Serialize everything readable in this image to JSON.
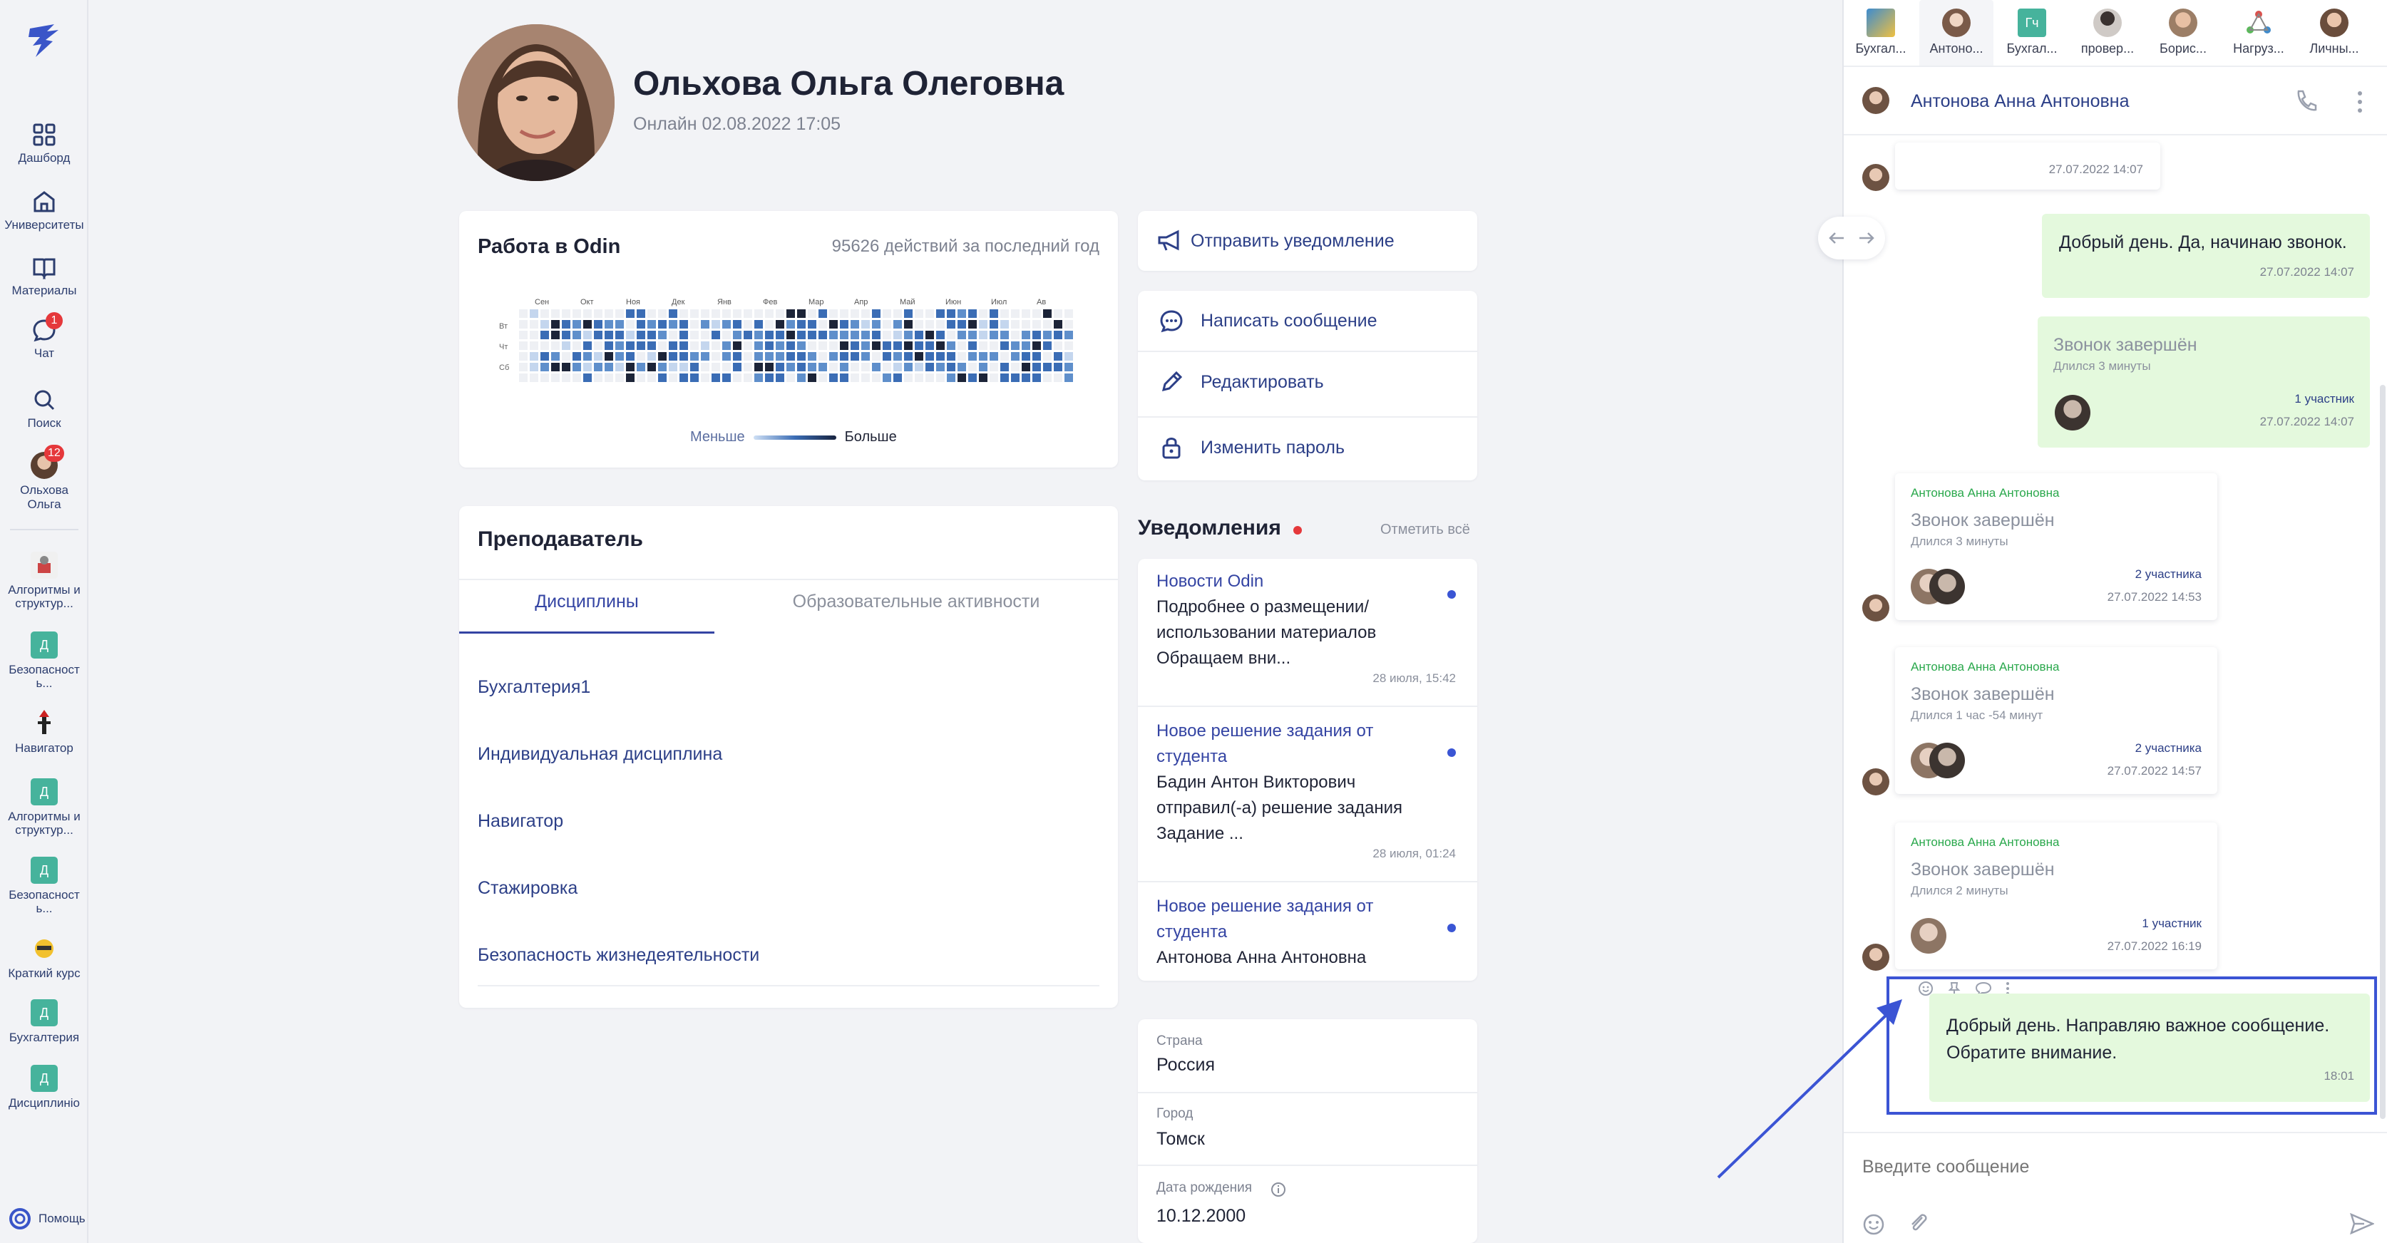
{
  "sidebar": {
    "nav": [
      {
        "label": "Дашборд",
        "icon": "dashboard-icon"
      },
      {
        "label": "Университеты",
        "icon": "university-icon"
      },
      {
        "label": "Материалы",
        "icon": "book-icon"
      },
      {
        "label": "Чат",
        "icon": "chat-icon",
        "badge": "1"
      },
      {
        "label": "Поиск",
        "icon": "search-icon"
      },
      {
        "label_line1": "Ольхова",
        "label_line2": "Ольга",
        "badge": "12"
      }
    ],
    "courses": [
      {
        "line1": "Алгоритмы и",
        "line2": "структур...",
        "icon_text": ""
      },
      {
        "line1": "Безопасност",
        "line2": "ь...",
        "icon_text": "Д"
      },
      {
        "line1": "Навигатор",
        "line2": "",
        "icon_text": ""
      },
      {
        "line1": "Алгоритмы и",
        "line2": "структур...",
        "icon_text": "Д"
      },
      {
        "line1": "Безопасност",
        "line2": "ь...",
        "icon_text": "Д"
      },
      {
        "line1": "Краткий курс",
        "line2": "",
        "icon_text": ""
      },
      {
        "line1": "Бухгалтерия",
        "line2": "",
        "icon_text": "Д"
      },
      {
        "line1": "Дисциплинiо",
        "line2": "",
        "icon_text": "Д"
      }
    ],
    "help": "Помощь"
  },
  "profile": {
    "name": "Ольхова Ольга Олеговна",
    "status": "Онлайн 02.08.2022 17:05"
  },
  "activity": {
    "title": "Работа в Odin",
    "summary": "95626 действий за последний год",
    "months": [
      "Сен",
      "Окт",
      "Ноя",
      "Дек",
      "Янв",
      "Фев",
      "Мар",
      "Апр",
      "Май",
      "Июн",
      "Июл",
      "Ав"
    ],
    "days": [
      "Вт",
      "Чт",
      "Сб"
    ],
    "legend_less": "Меньше",
    "legend_more": "Больше"
  },
  "actions": {
    "send_notification": "Отправить уведомление",
    "write_message": "Написать сообщение",
    "edit": "Редактировать",
    "change_password": "Изменить пароль"
  },
  "teacher": {
    "title": "Преподаватель",
    "tabs": [
      "Дисциплины",
      "Образовательные активности"
    ],
    "disciplines": [
      "Бухгалтерия1",
      "Индивидуальная дисциплина",
      "Навигатор",
      "Стажировка",
      "Безопасность жизнедеятельности"
    ]
  },
  "notifications": {
    "title": "Уведомления",
    "mark_all": "Отметить всё",
    "items": [
      {
        "title": "Новости Odin",
        "body": [
          "Подробнее о размещении/",
          "использовании материалов",
          "Обращаем вни..."
        ],
        "time": "28 июля, 15:42"
      },
      {
        "title": "Новое решение задания от студента",
        "body": [
          "Бадин Антон Викторович",
          "отправил(-а) решение задания",
          "Задание ..."
        ],
        "time": "28 июля, 01:24"
      },
      {
        "title": "Новое решение задания от студента",
        "body": [
          "Антонова Анна Антоновна"
        ],
        "time": ""
      }
    ]
  },
  "info": {
    "country_label": "Страна",
    "country": "Россия",
    "city_label": "Город",
    "city": "Томск",
    "birth_label": "Дата рождения",
    "birth": "10.12.2000"
  },
  "chat": {
    "tabs": [
      "Бухгал...",
      "Антоно...",
      "Бухгал...",
      "провер...",
      "Борис...",
      "Нагруз...",
      "Личны..."
    ],
    "tab3_badge": "Гч",
    "contact": "Антонова Анна Антоновна",
    "messages": {
      "m0_time": "27.07.2022 14:07",
      "m1_text": "Добрый день. Да, начинаю звонок.",
      "m1_time": "27.07.2022 14:07",
      "m2_title": "Звонок завершён",
      "m2_dur": "Длился 3 минуты",
      "m2_parts": "1 участник",
      "m2_time": "27.07.2022 14:07",
      "m3_sender": "Антонова Анна Антоновна",
      "m3_title": "Звонок завершён",
      "m3_dur": "Длился 3 минуты",
      "m3_parts": "2 участника",
      "m3_time": "27.07.2022 14:53",
      "m4_sender": "Антонова Анна Антоновна",
      "m4_title": "Звонок завершён",
      "m4_dur": "Длился 1 час -54 минут",
      "m4_parts": "2 участника",
      "m4_time": "27.07.2022 14:57",
      "m5_sender": "Антонова Анна Антоновна",
      "m5_title": "Звонок завершён",
      "m5_dur": "Длился 2 минуты",
      "m5_parts": "1 участник",
      "m5_time": "27.07.2022 16:19",
      "m6_line1": "Добрый день. Направляю важное сообщение.",
      "m6_line2": "Обратите внимание.",
      "m6_time": "18:01"
    },
    "input_placeholder": "Введите сообщение"
  },
  "colors": {
    "accent": "#2c3f87",
    "highlight": "#3b54d4",
    "green_bubble": "#e4f9dd",
    "badge": "#e5383b"
  }
}
